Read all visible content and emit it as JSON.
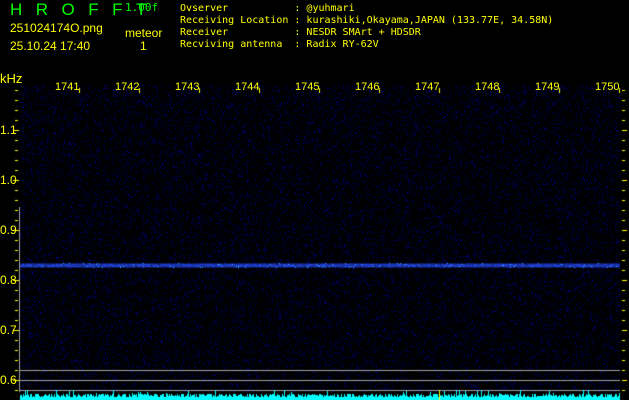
{
  "header": {
    "app_title": "HROFFT",
    "version": "1.00f",
    "filename": "251024174O.png",
    "datetime": "25.10.24 17:40",
    "meteor_label": "meteor",
    "meteor_count": "1"
  },
  "info": [
    {
      "label": "Ovserver           ",
      "value": ": @yuhmari"
    },
    {
      "label": "Receiving Location ",
      "value": ": kurashiki,Okayama,JAPAN (133.77E, 34.58N)"
    },
    {
      "label": "Receiver           ",
      "value": ": NESDR SMArt + HDSDR"
    },
    {
      "label": "Recviving antenna  ",
      "value": ": Radix RY-62V"
    }
  ],
  "axes": {
    "y_unit": "kHz",
    "y_ticks": [
      "1.1",
      "1.0",
      "0.9",
      "0.8",
      "0.7",
      "0.6"
    ],
    "x_ticks": [
      "1741",
      "1742",
      "1743",
      "1744",
      "1745",
      "1746",
      "1747",
      "1748",
      "1749",
      "1750"
    ]
  },
  "colors": {
    "text": "#ffff00",
    "title": "#00ff00",
    "signal": "#2040ff",
    "spectrum": "#00ffff",
    "guide": "#a0a0a0"
  },
  "signal_band_khz": 0.83
}
